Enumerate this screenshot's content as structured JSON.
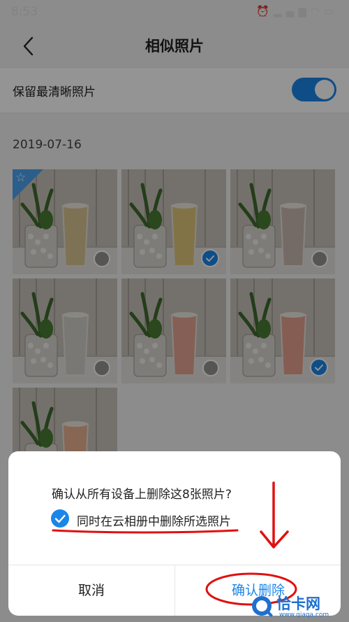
{
  "status_bar": {
    "time": "8:53",
    "icons": [
      "alarm-icon",
      "signal-icon",
      "wifi-icon",
      "battery-icon"
    ]
  },
  "header": {
    "title": "相似照片",
    "back_icon": "chevron-left-icon"
  },
  "setting": {
    "label": "保留最清晰照片",
    "toggle_on": true
  },
  "group": {
    "date": "2019-07-16",
    "photos": [
      {
        "selected": false,
        "best": true
      },
      {
        "selected": true,
        "best": false
      },
      {
        "selected": false,
        "best": false
      },
      {
        "selected": false,
        "best": false
      },
      {
        "selected": false,
        "best": false
      },
      {
        "selected": true,
        "best": false
      },
      {
        "selected": false,
        "best": false
      }
    ]
  },
  "dialog": {
    "message": "确认从所有设备上删除这8张照片?",
    "checkbox_label": "同时在云相册中删除所选照片",
    "checkbox_checked": true,
    "cancel_label": "取消",
    "confirm_label": "确认删除"
  },
  "watermark": {
    "text": "恰卡网",
    "sub": "www.qiaqa.com"
  },
  "colors": {
    "accent": "#1a86e8",
    "annotation": "#e01010"
  }
}
